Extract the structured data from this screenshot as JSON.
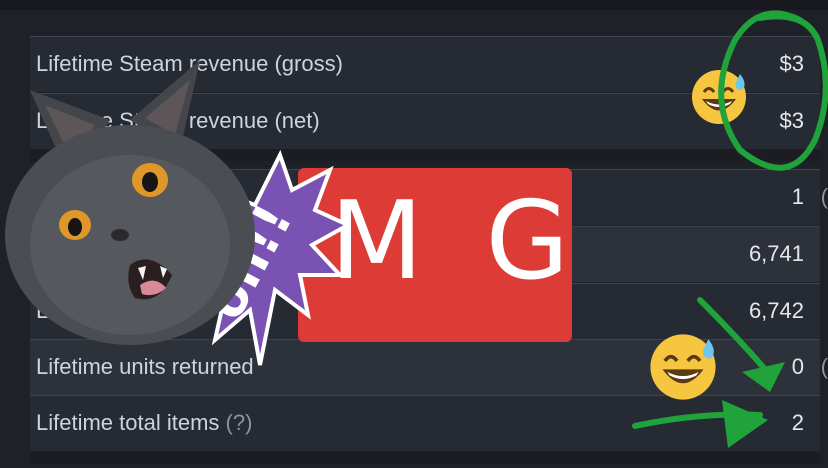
{
  "rows": [
    {
      "label": "Lifetime Steam revenue (gross)",
      "value": "$3"
    },
    {
      "label": "Lifetime Steam revenue (net)",
      "value": "$3"
    },
    {
      "label": "",
      "value": "1"
    },
    {
      "label": "",
      "value": "6,741"
    },
    {
      "label": "L",
      "value": "6,742"
    },
    {
      "label": "Lifetime units returned",
      "value": "0"
    },
    {
      "label": "Lifetime total items",
      "help": "(?)",
      "value": "2"
    }
  ],
  "meme": {
    "banner_text": "M G",
    "burst_text": "oh!!",
    "banner_color": "#dd3b36",
    "burst_color": "#7a52b3",
    "scribble_color": "#1fa33a",
    "cat_color": "#4a4d52",
    "emoji": "sweat-smile-emoji"
  }
}
